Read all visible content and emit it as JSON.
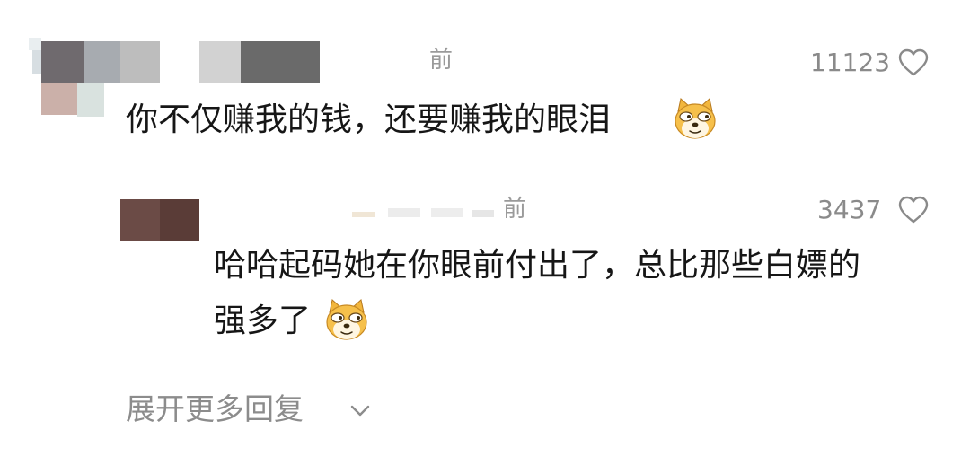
{
  "main_comment": {
    "time_suffix": "前",
    "like_count": "11123",
    "text": "你不仅赚我的钱，还要赚我的眼泪",
    "emoji_icon": "doge-emoji-icon"
  },
  "reply": {
    "time_suffix": "前",
    "like_count": "3437",
    "text_line1": "哈哈起码她在你眼前付出了，总比那些白嫖的",
    "text_line2": "强多了",
    "emoji_icon": "doge-emoji-icon"
  },
  "expand_replies": {
    "label": "展开更多回复",
    "icon": "chevron-down-icon"
  },
  "colors": {
    "like_gray": "#8a8a8a",
    "text_dark": "#161616",
    "emoji_yellow": "#f6b840"
  }
}
